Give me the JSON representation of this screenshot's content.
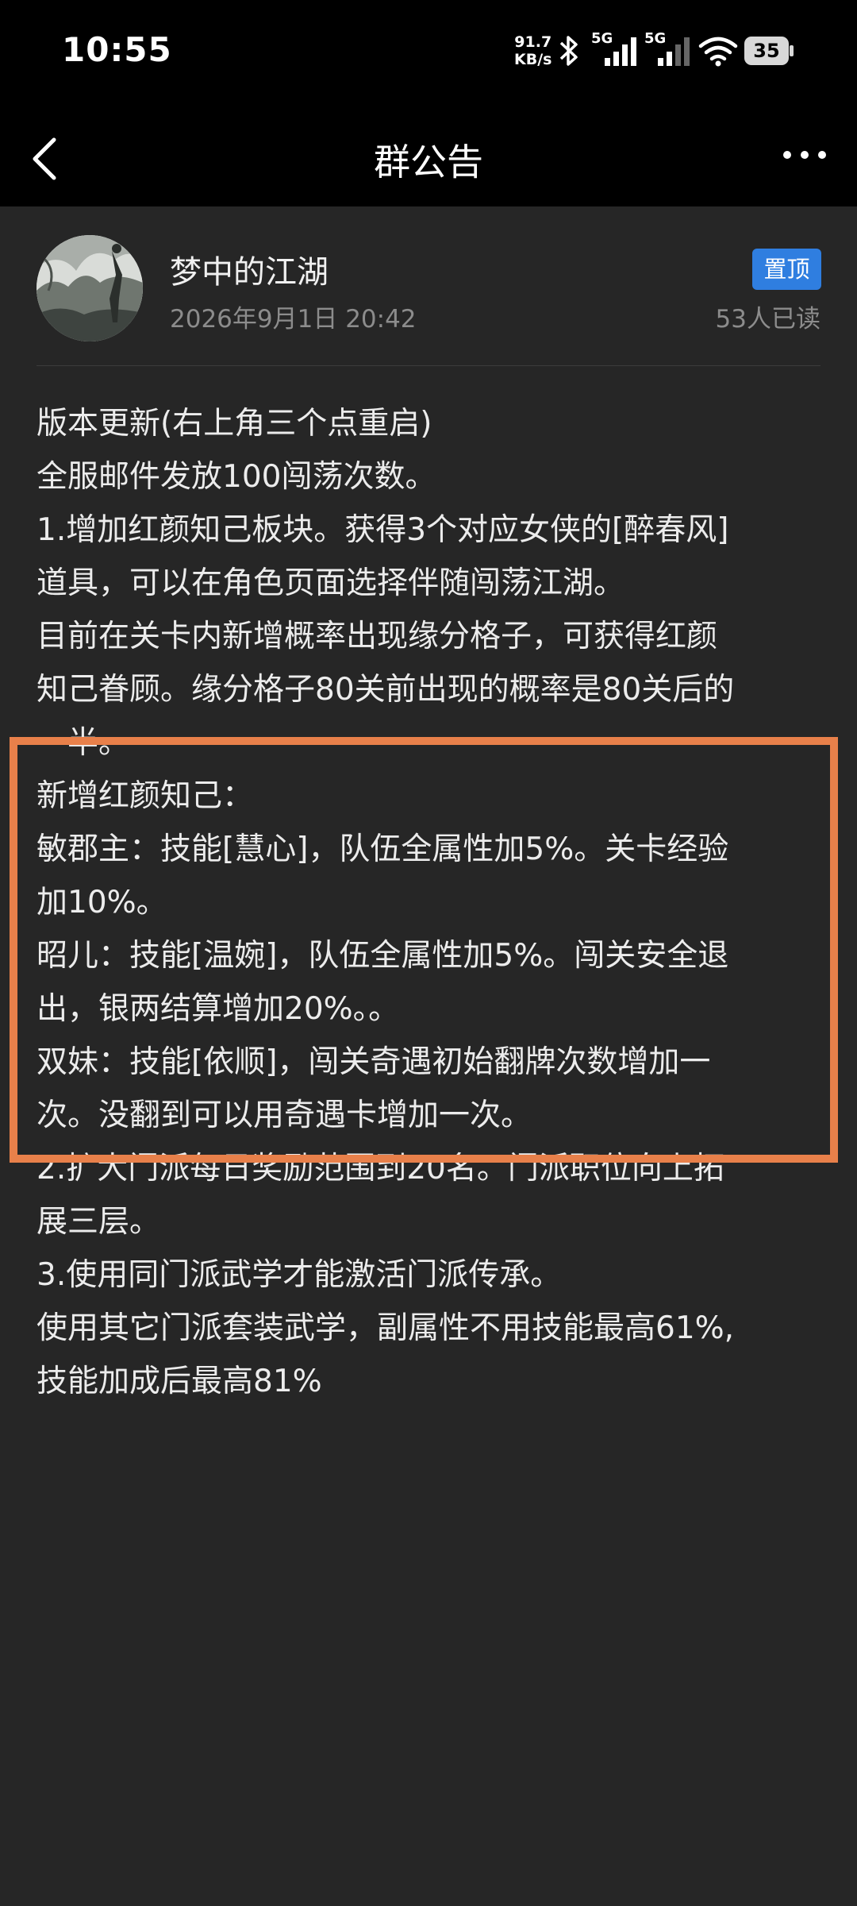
{
  "status_bar": {
    "time": "10:55",
    "speed_value": "91.7",
    "speed_unit": "KB/s",
    "signal1_label": "5G",
    "signal2_label": "5G",
    "battery": "35"
  },
  "nav": {
    "title": "群公告"
  },
  "post": {
    "author": "梦中的江湖",
    "date": "2026年9月1日 20:42",
    "pin_label": "置顶",
    "read_count": "53人已读"
  },
  "content": {
    "lines": [
      "版本更新(右上角三个点重启)",
      "全服邮件发放100闯荡次数。",
      "1.增加红颜知己板块。获得3个对应女侠的[醉春风]",
      "道具，可以在角色页面选择伴随闯荡江湖。",
      "目前在关卡内新增概率出现缘分格子，可获得红颜",
      "知己眷顾。缘分格子80关前出现的概率是80关后的",
      "一半。",
      "新增红颜知己：",
      "敏郡主：技能[慧心]，队伍全属性加5%。关卡经验",
      "加10%。",
      "昭儿：技能[温婉]，队伍全属性加5%。闯关安全退",
      "出，银两结算增加20%。。",
      "双妹：技能[依顺]，闯关奇遇初始翻牌次数增加一",
      "次。没翻到可以用奇遇卡增加一次。",
      "2.扩大门派每日奖励范围到20名。门派职位向上拓",
      "展三层。",
      "3.使用同门派武学才能激活门派传承。",
      "使用其它门派套装武学，副属性不用技能最高61%,",
      "技能加成后最高81%"
    ]
  },
  "colors": {
    "background": "#262626",
    "bars": "#000000",
    "pin": "#2f7ee0",
    "highlight": "#e8804a",
    "meta_text": "#8c8c8c"
  }
}
